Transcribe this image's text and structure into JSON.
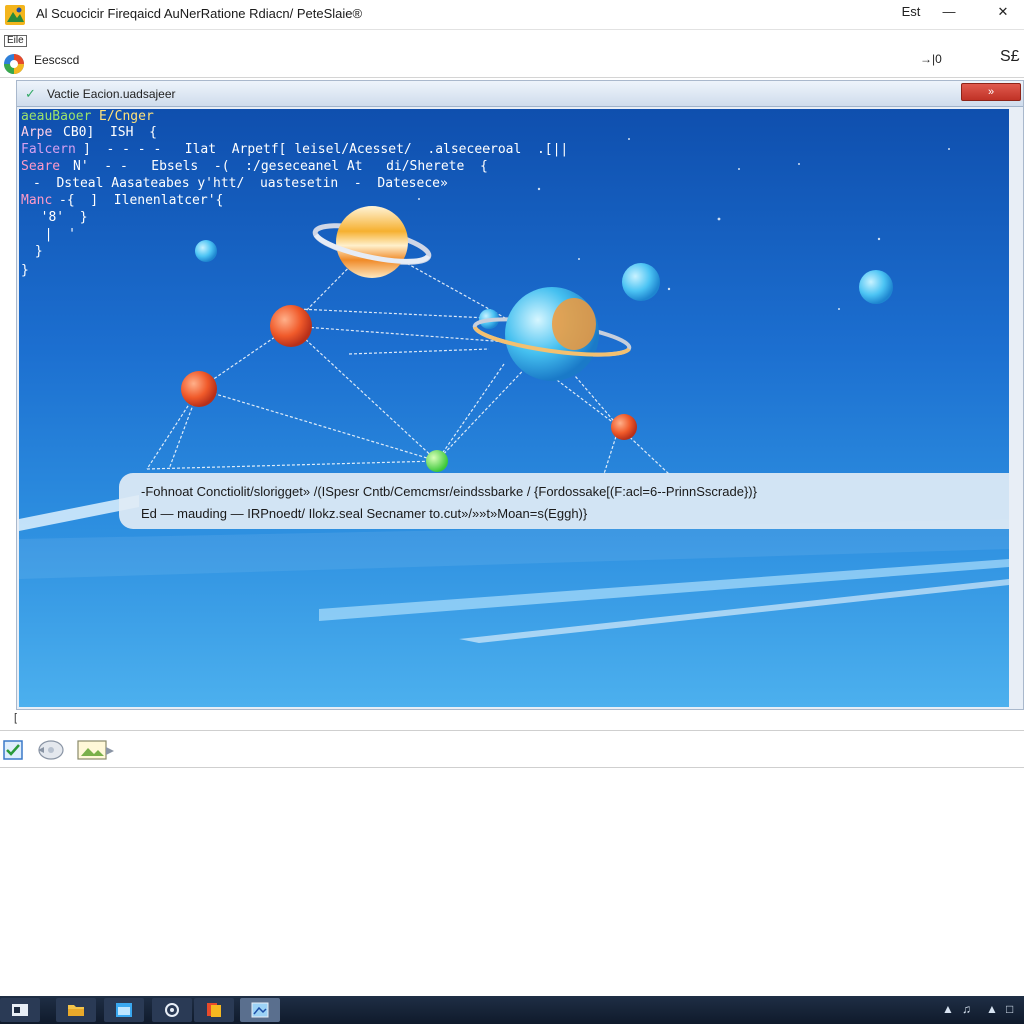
{
  "window": {
    "title": "Al Scuocicir Fireqaicd AuNerRatione Rdiacn/ PeteSlaie®",
    "controls": {
      "extra": "Est",
      "minimize": "—",
      "close": "✕"
    }
  },
  "toolbar": {
    "menu_tag": "Eile",
    "address": "Eescscd",
    "right_icon": "→|0",
    "right_text": "S£"
  },
  "inner_window": {
    "title": "Vactie Eacion.uadsajeer",
    "close_label": "»"
  },
  "code": {
    "lines": [
      {
        "key": "aeauBaoer",
        "text": "E/Cnger"
      },
      {
        "key": "Arpe",
        "text": "CB0]  ISH  {"
      },
      {
        "key": "Falcern",
        "text": "]  - - - -   Ilat  Arpetf[ leisel/Acesset/  .alseceeroal  .[||"
      },
      {
        "key": "Seare",
        "text": "N'  - -   Ebsels  -(  :/geseceanel At   di/Sherete  {"
      },
      {
        "key": "",
        "text": "-  Dsteal Aasateabes y'htt/  uastesetin  -  Datesece»"
      },
      {
        "key": "Manc",
        "text": "-{  ]  Ilenenlatcer'{"
      },
      {
        "key": "",
        "text": "  '8'  }"
      },
      {
        "key": "",
        "text": "  |  '"
      },
      {
        "key": "",
        "text": " }"
      },
      {
        "key": "",
        "text": "}"
      }
    ]
  },
  "caption": {
    "line1": "-Fohnoat Conctiolit/slorigget» /(ISpesr Cntb/Cemcmsr/eindssbarke / {Fordossake[(F:acl=6--PrinnSscrade})}",
    "line2": "Ed  — mauding — IRPnoedt/ Ilokz.seal Secnamer to.cut»/»»t»Moan=s(Eggh)}"
  },
  "status": {
    "indicator": "["
  },
  "icons": {
    "app": "app-icon",
    "browser": "browser-icon",
    "bottom_toolbar": [
      "check-doc-icon",
      "disc-icon",
      "image-icon"
    ],
    "taskbar": [
      "explorer-icon",
      "folder-icon",
      "window-icon",
      "settings-icon",
      "files-icon",
      "app-active-icon"
    ],
    "tray": [
      "network-icon",
      "sound-icon",
      "wifi-icon",
      "message-icon"
    ]
  },
  "colors": {
    "scene_top": "#0f4fae",
    "scene_bottom": "#4cb0ee",
    "close_red": "#d5433a",
    "taskbar": "#16233a"
  }
}
